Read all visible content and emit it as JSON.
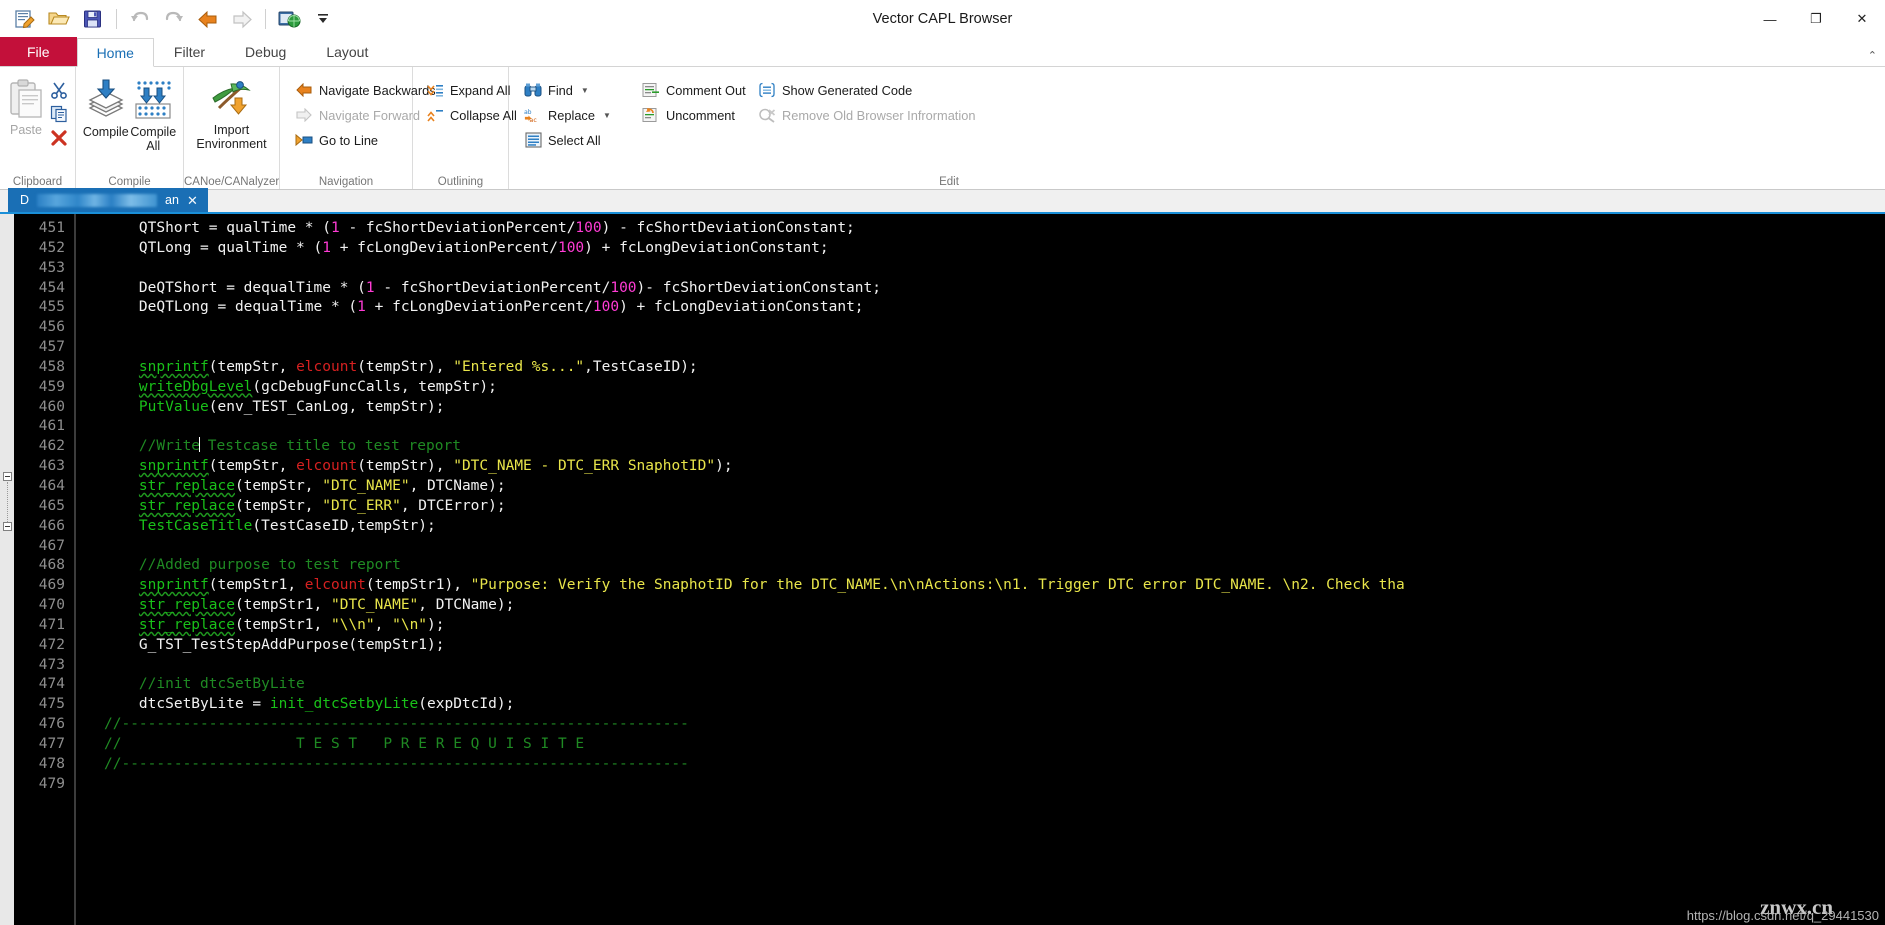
{
  "window": {
    "title": "Vector CAPL Browser",
    "minimize": "—",
    "maximize": "❐",
    "close": "✕"
  },
  "quick_access": [
    {
      "name": "new-file-icon",
      "tooltip": "New"
    },
    {
      "name": "open-folder-icon",
      "tooltip": "Open"
    },
    {
      "name": "save-icon",
      "tooltip": "Save"
    },
    {
      "name": "undo-icon",
      "tooltip": "Undo"
    },
    {
      "name": "redo-icon",
      "tooltip": "Redo"
    },
    {
      "name": "navigate-back-icon",
      "tooltip": "Back"
    },
    {
      "name": "navigate-forward-icon",
      "tooltip": "Forward"
    },
    {
      "name": "import-environment-icon",
      "tooltip": "Environment"
    },
    {
      "name": "customize-qat-icon",
      "tooltip": "Customize Quick Access Toolbar"
    }
  ],
  "ribbon": {
    "tabs": [
      {
        "label": "File",
        "kind": "file"
      },
      {
        "label": "Home",
        "kind": "active"
      },
      {
        "label": "Filter",
        "kind": "normal"
      },
      {
        "label": "Debug",
        "kind": "normal"
      },
      {
        "label": "Layout",
        "kind": "normal"
      }
    ],
    "collapse_icon": "⌃",
    "groups": [
      {
        "label": "Clipboard",
        "paste_label": "Paste",
        "mini": [
          {
            "label": "Cut",
            "icon": "scissors-icon"
          },
          {
            "label": "Copy",
            "icon": "copy-icon"
          },
          {
            "label": "Delete",
            "icon": "delete-icon"
          }
        ]
      },
      {
        "label": "Compile",
        "buttons": [
          {
            "label": "Compile",
            "icon": "compile-icon"
          },
          {
            "label": "Compile\nAll",
            "icon": "compile-all-icon"
          }
        ]
      },
      {
        "label": "CANoe/CANalyzer",
        "buttons": [
          {
            "label": "Import\nEnvironment",
            "icon": "import-environment-icon"
          }
        ]
      },
      {
        "label": "Navigation",
        "items": [
          {
            "label": "Navigate Backwards",
            "icon": "arrow-left-icon",
            "disabled": false
          },
          {
            "label": "Navigate Forward",
            "icon": "arrow-right-icon",
            "disabled": true
          },
          {
            "label": "Go to Line",
            "icon": "goto-line-icon",
            "disabled": false
          }
        ]
      },
      {
        "label": "Outlining",
        "items": [
          {
            "label": "Expand All",
            "icon": "expand-all-icon",
            "disabled": false
          },
          {
            "label": "Collapse All",
            "icon": "collapse-all-icon",
            "disabled": false
          }
        ]
      },
      {
        "label": "Edit",
        "col1": [
          {
            "label": "Find",
            "icon": "binoculars-icon",
            "dropdown": true,
            "disabled": false
          },
          {
            "label": "Replace",
            "icon": "replace-icon",
            "dropdown": true,
            "disabled": false
          },
          {
            "label": "Select All",
            "icon": "select-all-icon",
            "dropdown": false,
            "disabled": false
          }
        ],
        "col2": [
          {
            "label": "Comment Out",
            "icon": "comment-out-icon",
            "disabled": false
          },
          {
            "label": "Uncomment",
            "icon": "uncomment-icon",
            "disabled": false
          }
        ],
        "col3": [
          {
            "label": "Show Generated Code",
            "icon": "show-generated-code-icon",
            "disabled": false
          },
          {
            "label": "Remove Old Browser Infrormation",
            "icon": "remove-old-browser-icon",
            "disabled": true
          }
        ]
      }
    ]
  },
  "document_tab": {
    "prefix": "D",
    "suffix": "an",
    "close_icon": "✕"
  },
  "editor": {
    "first_line_number": 451,
    "lines": [
      {
        "n": 451,
        "t": [
          [
            "p",
            "    QTShort = qualTime * ("
          ],
          [
            "n",
            "1"
          ],
          [
            "p",
            " - fcShortDeviationPercent/"
          ],
          [
            "n",
            "100"
          ],
          [
            "p",
            ") - fcShortDeviationConstant;"
          ]
        ]
      },
      {
        "n": 452,
        "t": [
          [
            "p",
            "    QTLong = qualTime * ("
          ],
          [
            "n",
            "1"
          ],
          [
            "p",
            " + fcLongDeviationPercent/"
          ],
          [
            "n",
            "100"
          ],
          [
            "p",
            ") + fcLongDeviationConstant;"
          ]
        ]
      },
      {
        "n": 453,
        "t": []
      },
      {
        "n": 454,
        "t": [
          [
            "p",
            "    DeQTShort = dequalTime * ("
          ],
          [
            "n",
            "1"
          ],
          [
            "p",
            " - fcShortDeviationPercent/"
          ],
          [
            "n",
            "100"
          ],
          [
            "p",
            ")- fcShortDeviationConstant;"
          ]
        ]
      },
      {
        "n": 455,
        "t": [
          [
            "p",
            "    DeQTLong = dequalTime * ("
          ],
          [
            "n",
            "1"
          ],
          [
            "p",
            " + fcLongDeviationPercent/"
          ],
          [
            "n",
            "100"
          ],
          [
            "p",
            ") + fcLongDeviationConstant;"
          ]
        ]
      },
      {
        "n": 456,
        "t": []
      },
      {
        "n": 457,
        "t": []
      },
      {
        "n": 458,
        "t": [
          [
            "p",
            "    "
          ],
          [
            "fu",
            "snprintf"
          ],
          [
            "p",
            "(tempStr, "
          ],
          [
            "e",
            "elcount"
          ],
          [
            "p",
            "(tempStr), "
          ],
          [
            "s",
            "\"Entered %s...\""
          ],
          [
            "p",
            ",TestCaseID);"
          ]
        ]
      },
      {
        "n": 459,
        "t": [
          [
            "p",
            "    "
          ],
          [
            "fu",
            "writeDbgLevel"
          ],
          [
            "p",
            "(gcDebugFuncCalls, tempStr);"
          ]
        ]
      },
      {
        "n": 460,
        "t": [
          [
            "p",
            "    "
          ],
          [
            "f",
            "PutValue"
          ],
          [
            "p",
            "(env_TEST_CanLog, tempStr);"
          ]
        ]
      },
      {
        "n": 461,
        "t": []
      },
      {
        "n": 462,
        "t": [
          [
            "p",
            "    "
          ],
          [
            "c",
            "//Write"
          ],
          [
            "cur",
            ""
          ],
          [
            "c",
            " Testcase title to test report"
          ]
        ]
      },
      {
        "n": 463,
        "t": [
          [
            "p",
            "    "
          ],
          [
            "fu",
            "snprintf"
          ],
          [
            "p",
            "(tempStr, "
          ],
          [
            "e",
            "elcount"
          ],
          [
            "p",
            "(tempStr), "
          ],
          [
            "s",
            "\"DTC_NAME - DTC_ERR SnaphotID\""
          ],
          [
            "p",
            ");"
          ]
        ]
      },
      {
        "n": 464,
        "t": [
          [
            "p",
            "    "
          ],
          [
            "fu",
            "str_replace"
          ],
          [
            "p",
            "(tempStr, "
          ],
          [
            "s",
            "\"DTC_NAME\""
          ],
          [
            "p",
            ", DTCName);"
          ]
        ]
      },
      {
        "n": 465,
        "t": [
          [
            "p",
            "    "
          ],
          [
            "fu",
            "str_replace"
          ],
          [
            "p",
            "(tempStr, "
          ],
          [
            "s",
            "\"DTC_ERR\""
          ],
          [
            "p",
            ", DTCError);"
          ]
        ]
      },
      {
        "n": 466,
        "t": [
          [
            "p",
            "    "
          ],
          [
            "f",
            "TestCaseTitle"
          ],
          [
            "p",
            "(TestCaseID,tempStr);"
          ]
        ]
      },
      {
        "n": 467,
        "t": []
      },
      {
        "n": 468,
        "t": [
          [
            "p",
            "    "
          ],
          [
            "c",
            "//Added purpose to test report"
          ]
        ]
      },
      {
        "n": 469,
        "t": [
          [
            "p",
            "    "
          ],
          [
            "fu",
            "snprintf"
          ],
          [
            "p",
            "(tempStr1, "
          ],
          [
            "e",
            "elcount"
          ],
          [
            "p",
            "(tempStr1), "
          ],
          [
            "s",
            "\"Purpose: Verify the SnaphotID for the DTC_NAME.\\n\\nActions:\\n1. Trigger DTC error DTC_NAME. \\n2. Check tha"
          ]
        ]
      },
      {
        "n": 470,
        "t": [
          [
            "p",
            "    "
          ],
          [
            "fu",
            "str_replace"
          ],
          [
            "p",
            "(tempStr1, "
          ],
          [
            "s",
            "\"DTC_NAME\""
          ],
          [
            "p",
            ", DTCName);"
          ]
        ]
      },
      {
        "n": 471,
        "t": [
          [
            "p",
            "    "
          ],
          [
            "fu",
            "str_replace"
          ],
          [
            "p",
            "(tempStr1, "
          ],
          [
            "s",
            "\"\\\\n\""
          ],
          [
            "p",
            ", "
          ],
          [
            "s",
            "\"\\n\""
          ],
          [
            "p",
            ");"
          ]
        ]
      },
      {
        "n": 472,
        "t": [
          [
            "p",
            "    G_TST_TestStepAddPurpose(tempStr1);"
          ]
        ]
      },
      {
        "n": 473,
        "t": []
      },
      {
        "n": 474,
        "t": [
          [
            "p",
            "    "
          ],
          [
            "c",
            "//init dtcSetByLite"
          ]
        ]
      },
      {
        "n": 475,
        "t": [
          [
            "p",
            "    dtcSetByLite = "
          ],
          [
            "f",
            "init_dtcSetbyLite"
          ],
          [
            "p",
            "(expDtcId);"
          ]
        ]
      },
      {
        "n": 476,
        "t": [
          [
            "c",
            "//-----------------------------------------------------------------"
          ]
        ]
      },
      {
        "n": 477,
        "t": [
          [
            "c",
            "//                    T E S T   P R E R E Q U I S I T E"
          ]
        ]
      },
      {
        "n": 478,
        "t": [
          [
            "c",
            "//-----------------------------------------------------------------"
          ]
        ]
      },
      {
        "n": 479,
        "t": []
      }
    ]
  },
  "watermark": {
    "url": "https://blog.csdn.net/q_29441530",
    "brand": "znwx.cn"
  },
  "colors": {
    "accent": "#1a6fb5",
    "file_tab": "#c3103a",
    "editor_bg": "#000000",
    "keyword_number": "#ff3cd5",
    "string": "#e8e54a",
    "comment": "#1f8a23",
    "function": "#19c119",
    "error": "#d62020"
  }
}
